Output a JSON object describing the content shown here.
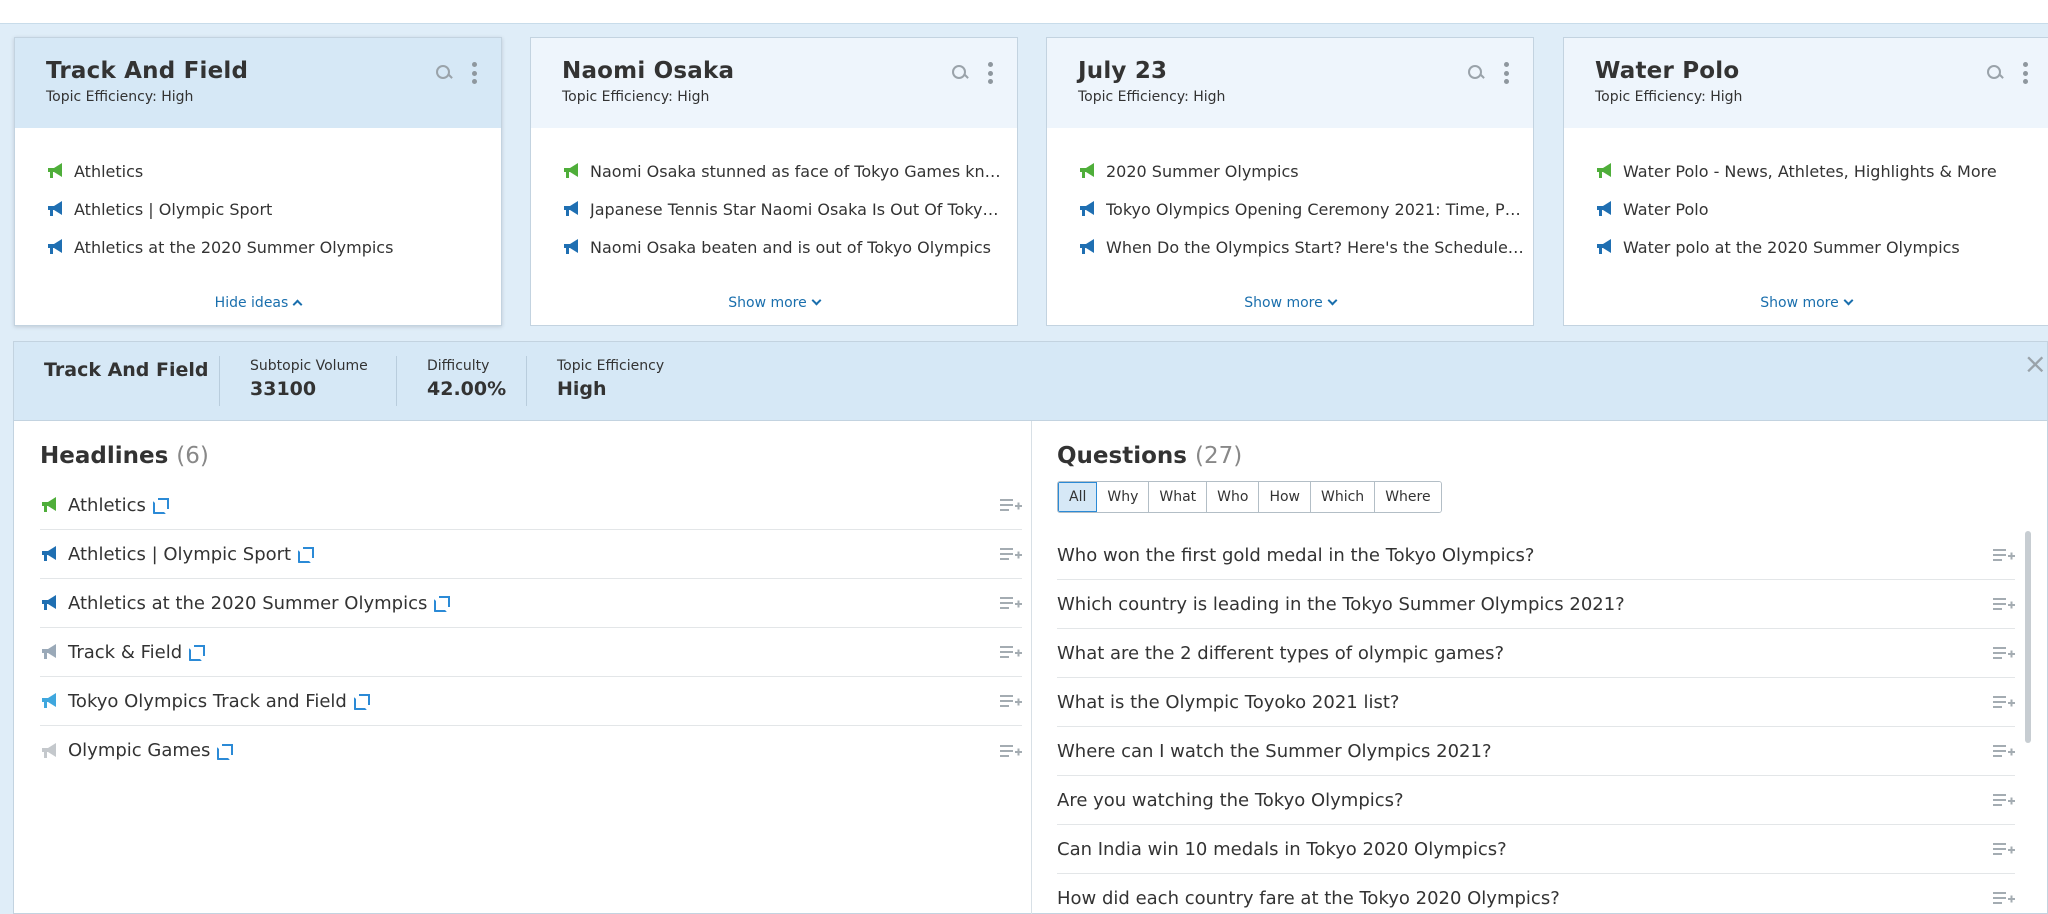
{
  "cards": [
    {
      "title": "Track And Field",
      "efficiency": "Topic Efficiency:  High",
      "items": [
        {
          "text": "Athletics",
          "icon": "megaphone-green"
        },
        {
          "text": "Athletics | Olympic Sport",
          "icon": "megaphone-blue"
        },
        {
          "text": "Athletics at the 2020 Summer Olympics",
          "icon": "megaphone-blue"
        }
      ],
      "footer": "Hide ideas"
    },
    {
      "title": "Naomi Osaka",
      "efficiency": "Topic Efficiency:  High",
      "items": [
        {
          "text": "Naomi Osaka stunned as face of Tokyo Games kn…",
          "icon": "megaphone-green"
        },
        {
          "text": "Japanese Tennis Star Naomi Osaka Is Out Of Toky…",
          "icon": "megaphone-blue"
        },
        {
          "text": "Naomi Osaka beaten and is out of Tokyo Olympics",
          "icon": "megaphone-blue"
        }
      ],
      "footer": "Show more"
    },
    {
      "title": "July 23",
      "efficiency": "Topic Efficiency:  High",
      "items": [
        {
          "text": "2020 Summer Olympics",
          "icon": "megaphone-green"
        },
        {
          "text": "Tokyo Olympics Opening Ceremony 2021: Time, P…",
          "icon": "megaphone-blue"
        },
        {
          "text": "When Do the Olympics Start? Here's the Schedule…",
          "icon": "megaphone-blue"
        }
      ],
      "footer": "Show more"
    },
    {
      "title": "Water Polo",
      "efficiency": "Topic Efficiency:  High",
      "items": [
        {
          "text": "Water Polo - News, Athletes, Highlights & More",
          "icon": "megaphone-green"
        },
        {
          "text": "Water Polo",
          "icon": "megaphone-blue"
        },
        {
          "text": "Water polo at the 2020 Summer Olympics",
          "icon": "megaphone-blue"
        }
      ],
      "footer": "Show more"
    }
  ],
  "detail": {
    "title": "Track And Field",
    "stats": [
      {
        "label": "Subtopic Volume",
        "value": "33100"
      },
      {
        "label": "Difficulty",
        "value": "42.00%"
      },
      {
        "label": "Topic Efficiency",
        "value": "High"
      }
    ],
    "close_label": "×"
  },
  "headlines": {
    "title": "Headlines",
    "count": "(6)",
    "items": [
      {
        "text": "Athletics",
        "icon": "megaphone-green"
      },
      {
        "text": "Athletics | Olympic Sport",
        "icon": "megaphone-blue"
      },
      {
        "text": "Athletics at the 2020 Summer Olympics",
        "icon": "megaphone-blue"
      },
      {
        "text": "Track & Field",
        "icon": "megaphone-lightgray"
      },
      {
        "text": "Tokyo Olympics Track and Field",
        "icon": "megaphone-lightblue"
      },
      {
        "text": "Olympic Games",
        "icon": "megaphone-gray"
      }
    ]
  },
  "questions": {
    "title": "Questions",
    "count": "(27)",
    "filters": [
      "All",
      "Why",
      "What",
      "Who",
      "How",
      "Which",
      "Where"
    ],
    "selected_filter": "All",
    "items": [
      "Who won the first gold medal in the Tokyo Olympics?",
      "Which country is leading in the Tokyo Summer Olympics 2021?",
      "What are the 2 different types of olympic games?",
      "What is the Olympic Toyoko 2021 list?",
      "Where can I watch the Summer Olympics 2021?",
      "Are you watching the Tokyo Olympics?",
      "Can India win 10 medals in Tokyo 2020 Olympics?",
      "How did each country fare at the Tokyo 2020 Olympics?"
    ]
  },
  "colors": {
    "accent": "#1a6fad",
    "green": "#4fae3a",
    "blue": "#1f6fb2",
    "panel": "#d6e8f6"
  }
}
